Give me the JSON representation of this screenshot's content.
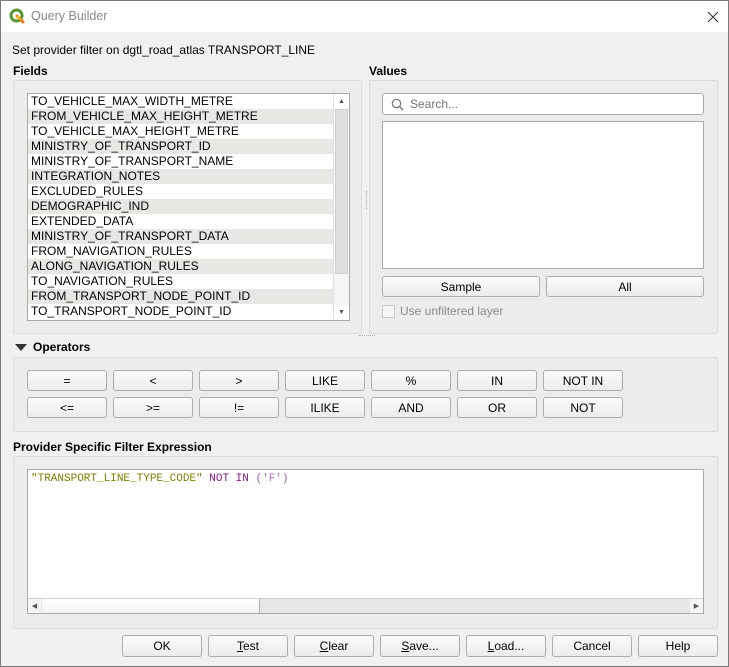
{
  "window": {
    "title": "Query Builder",
    "close_icon": "close-icon",
    "app_icon": "qgis-logo-icon"
  },
  "heading": "Set provider filter on dgtl_road_atlas TRANSPORT_LINE",
  "fields": {
    "label": "Fields",
    "items": [
      "TO_VEHICLE_MAX_WIDTH_METRE",
      "FROM_VEHICLE_MAX_HEIGHT_METRE",
      "TO_VEHICLE_MAX_HEIGHT_METRE",
      "MINISTRY_OF_TRANSPORT_ID",
      "MINISTRY_OF_TRANSPORT_NAME",
      "INTEGRATION_NOTES",
      "EXCLUDED_RULES",
      "DEMOGRAPHIC_IND",
      "EXTENDED_DATA",
      "MINISTRY_OF_TRANSPORT_DATA",
      "FROM_NAVIGATION_RULES",
      "ALONG_NAVIGATION_RULES",
      "TO_NAVIGATION_RULES",
      "FROM_TRANSPORT_NODE_POINT_ID",
      "TO_TRANSPORT_NODE_POINT_ID"
    ],
    "scroll_up_icon": "scroll-up-arrow-icon",
    "scroll_down_icon": "scroll-down-arrow-icon"
  },
  "values": {
    "label": "Values",
    "search_placeholder": "Search...",
    "search_value": "",
    "sample_label": "Sample",
    "all_label": "All",
    "use_unfiltered_label": "Use unfiltered layer",
    "use_unfiltered_checked": false,
    "use_unfiltered_enabled": false
  },
  "operators": {
    "label": "Operators",
    "expanded": true,
    "row1": [
      "=",
      "<",
      ">",
      "LIKE",
      "%",
      "IN",
      "NOT IN"
    ],
    "row2": [
      "<=",
      ">=",
      "!=",
      "ILIKE",
      "AND",
      "OR",
      "NOT"
    ]
  },
  "expression": {
    "label": "Provider Specific Filter Expression",
    "tokens": [
      {
        "text": "\"TRANSPORT_LINE_TYPE_CODE\"",
        "kind": "string"
      },
      {
        "text": " ",
        "kind": "space"
      },
      {
        "text": "NOT",
        "kind": "keyword"
      },
      {
        "text": " ",
        "kind": "space"
      },
      {
        "text": "IN",
        "kind": "keyword"
      },
      {
        "text": " ",
        "kind": "space"
      },
      {
        "text": "(",
        "kind": "paren"
      },
      {
        "text": "'F'",
        "kind": "literal"
      },
      {
        "text": ")",
        "kind": "paren"
      }
    ],
    "colors": {
      "string": "#808000",
      "keyword": "#8b1a8b",
      "literal": "#b56bc2"
    }
  },
  "buttons": {
    "ok": "OK",
    "test": "Test",
    "clear": "Clear",
    "save": "Save...",
    "load": "Load...",
    "cancel": "Cancel",
    "help": "Help"
  }
}
